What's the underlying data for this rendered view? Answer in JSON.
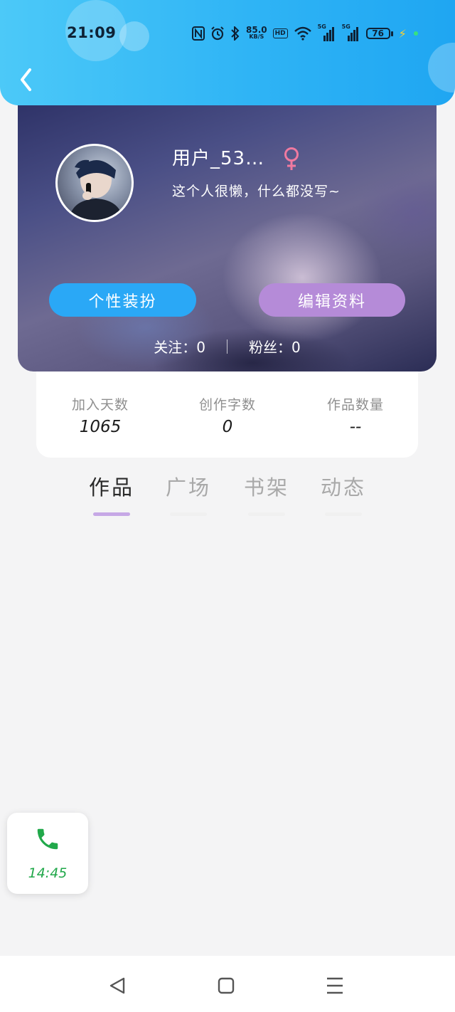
{
  "status_bar": {
    "time": "21:09",
    "net_speed_value": "85.0",
    "net_speed_unit": "KB/S",
    "hd_label": "HD",
    "signal1_label": "5G",
    "signal2_label": "5G",
    "battery_level": "76",
    "icons": [
      "nfc-icon",
      "alarm-icon",
      "bluetooth-icon",
      "wifi-icon",
      "signal-icon",
      "battery-icon",
      "charging-icon"
    ]
  },
  "header": {
    "back_icon": "chevron-left-icon"
  },
  "profile": {
    "username": "用户_53…",
    "gender_icon": "female-icon",
    "bio": "这个人很懒，什么都没写~",
    "dress_button": "个性装扮",
    "edit_button": "编辑资料",
    "following": "关注：0",
    "followers": "粉丝：0"
  },
  "stats": [
    {
      "label": "加入天数",
      "value": "1065"
    },
    {
      "label": "创作字数",
      "value": "0"
    },
    {
      "label": "作品数量",
      "value": "--"
    }
  ],
  "tabs": [
    {
      "label": "作品",
      "active": true
    },
    {
      "label": "广场",
      "active": false
    },
    {
      "label": "书架",
      "active": false
    },
    {
      "label": "动态",
      "active": false
    }
  ],
  "call_float": {
    "icon": "phone-icon",
    "time": "14:45"
  },
  "navbar": {
    "icons": [
      "back-triangle-icon",
      "home-square-icon",
      "menu-icon"
    ]
  },
  "colors": {
    "header_blue": "#2fb4f5",
    "dress_button": "#2aa8f6",
    "edit_button": "#b58bd8",
    "tab_underline": "#c6a8e6",
    "gender_pink": "#f07aa0",
    "call_green": "#21a84a"
  }
}
